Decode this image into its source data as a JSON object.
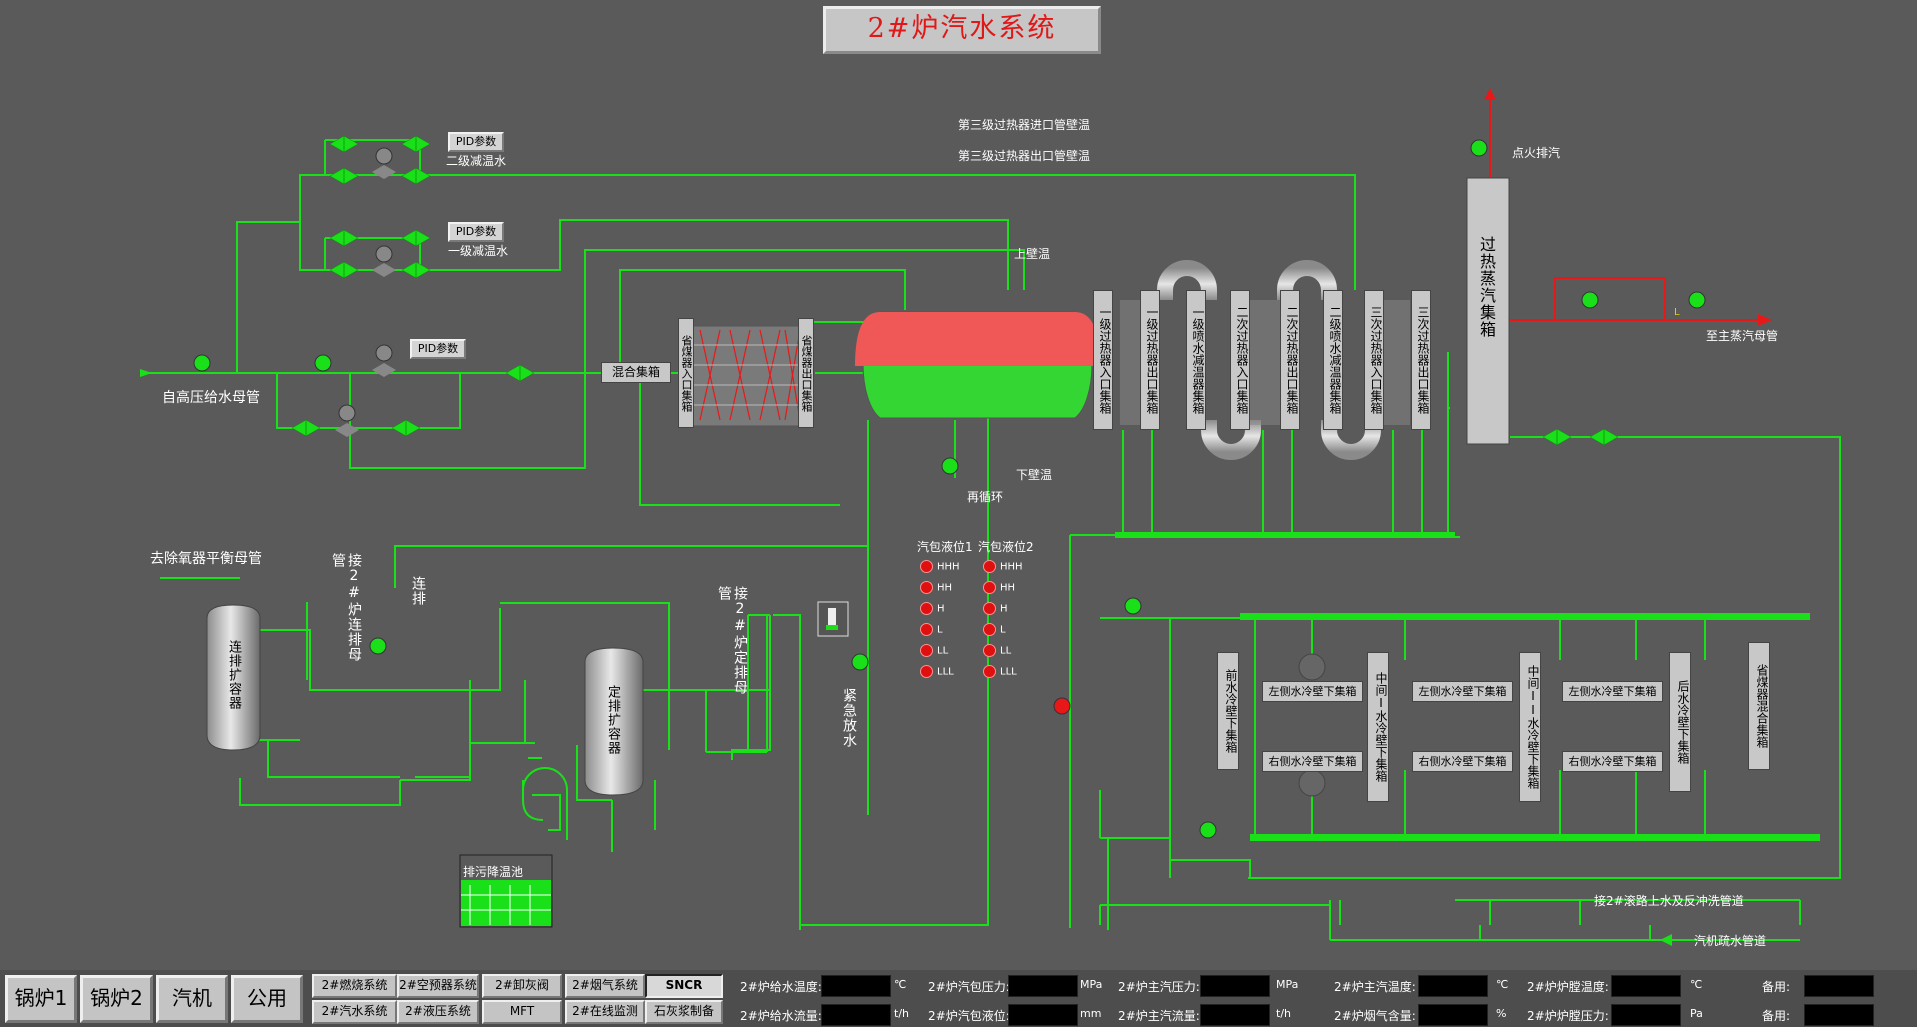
{
  "title": "2#炉汽水系统",
  "pid_buttons": {
    "stage2": "PID参数",
    "stage1": "PID参数",
    "feed": "PID参数"
  },
  "labels": {
    "stage2_desuperheat": "二级减温水",
    "stage1_desuperheat": "一级减温水",
    "feedwater_source": "自高压给水母管",
    "stage3_inlet_temp": "第三级过热器进口管壁温",
    "stage3_outlet_temp": "第三级过热器出口管壁温",
    "upper_wall_temp": "上壁温",
    "lower_wall_temp": "下壁温",
    "recirculation": "再循环",
    "mixing_header": "混合集箱",
    "ignition_vent": "点火排汽",
    "main_steam": "至主蒸汽母管",
    "deaerator": "去除氧器平衡母管",
    "cont_blowdown_header": "接2#炉连排母管",
    "cont_blowdown": "连排",
    "periodic_blowdown_header": "接2#炉定排母管",
    "emergency_drain": "紧急放水",
    "cont_blowdown_vessel": "连排扩容器",
    "periodic_blowdown_vessel": "定排扩容器",
    "cooling_pool": "排污降温池",
    "drum_level1": "汽包液位1",
    "drum_level2": "汽包液位2",
    "roller_water": "接2#滚路上水及反冲洗管道",
    "turbine_drain": "汽机疏水管道",
    "superheated_header": "过热蒸汽集箱",
    "marker_l": "L"
  },
  "level_alarms": [
    "HHH",
    "HH",
    "H",
    "L",
    "LL",
    "LLL"
  ],
  "economizer_headers": {
    "inlet": "省煤器入口集箱",
    "outlet": "省煤器出口集箱"
  },
  "superheater_headers": [
    "一级过热器入口集箱",
    "一级过热器出口集箱",
    "一级喷水减温器集箱",
    "二次过热器入口集箱",
    "二次过热器出口集箱",
    "二级喷水减温器集箱",
    "三次过热器入口集箱",
    "三次过热器出口集箱"
  ],
  "waterwall": {
    "front": "前水冷壁下集箱",
    "middle1": "中间I水冷壁下集箱",
    "middle2": "中间II水冷壁下集箱",
    "rear": "后水冷壁下集箱",
    "econ_mix": "省煤器混合集箱",
    "left": "左侧水冷壁下集箱",
    "right": "右侧水冷壁下集箱"
  },
  "nav": {
    "main": [
      "锅炉1",
      "锅炉2",
      "汽机",
      "公用"
    ],
    "sub": [
      {
        "label": "2#燃烧系统",
        "selected": false
      },
      {
        "label": "2#空预器系统",
        "selected": false
      },
      {
        "label": "2#卸灰阀",
        "selected": false
      },
      {
        "label": "2#烟气系统",
        "selected": false
      },
      {
        "label": "SNCR",
        "selected": true
      },
      {
        "label": "2#汽水系统",
        "selected": false
      },
      {
        "label": "2#液压系统",
        "selected": false
      },
      {
        "label": "MFT",
        "selected": false
      },
      {
        "label": "2#在线监测",
        "selected": false
      },
      {
        "label": "石灰浆制备",
        "selected": false
      }
    ]
  },
  "readouts": [
    {
      "label": "2#炉给水温度:",
      "unit": "℃",
      "value": ""
    },
    {
      "label": "2#炉汽包压力:",
      "unit": "MPa",
      "value": ""
    },
    {
      "label": "2#炉主汽压力:",
      "unit": "MPa",
      "value": ""
    },
    {
      "label": "2#炉主汽温度:",
      "unit": "℃",
      "value": ""
    },
    {
      "label": "2#炉炉膛温度:",
      "unit": "℃",
      "value": ""
    },
    {
      "label": "备用:",
      "unit": "",
      "value": ""
    },
    {
      "label": "2#炉给水流量:",
      "unit": "t/h",
      "value": ""
    },
    {
      "label": "2#炉汽包液位:",
      "unit": "mm",
      "value": ""
    },
    {
      "label": "2#炉主汽流量:",
      "unit": "t/h",
      "value": ""
    },
    {
      "label": "2#炉烟气含量:",
      "unit": "%",
      "value": ""
    },
    {
      "label": "2#炉炉膛压力:",
      "unit": "Pa",
      "value": ""
    },
    {
      "label": "备用:",
      "unit": "",
      "value": ""
    }
  ],
  "colors": {
    "pipe": "#19e019",
    "steam": "#e81818",
    "background": "#5a5a5a",
    "drum_top": "#f05858",
    "drum_bottom": "#33d633"
  }
}
